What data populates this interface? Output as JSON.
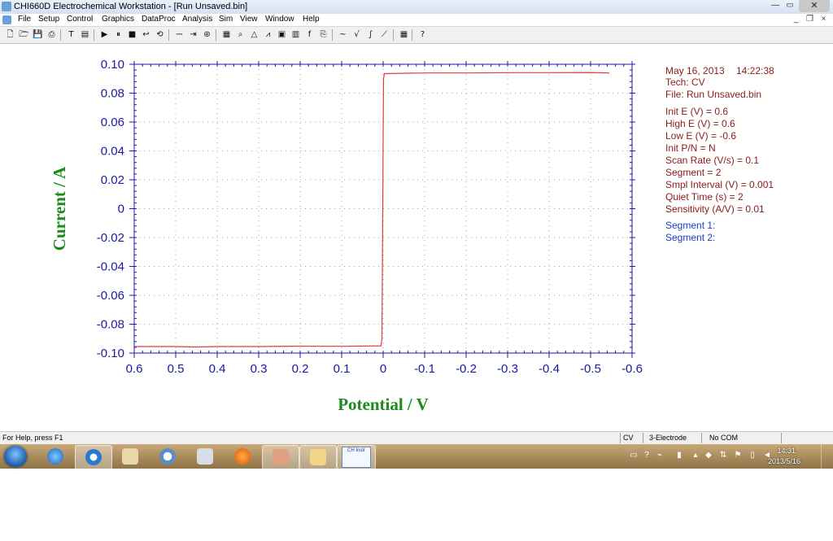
{
  "window": {
    "title": "CHI660D Electrochemical Workstation - [Run Unsaved.bin]",
    "min_glyph": "—",
    "max_glyph": "▭",
    "close_glyph": "✕",
    "mdi_min_glyph": "_",
    "mdi_restore_glyph": "❐",
    "mdi_close_glyph": "×"
  },
  "menu": [
    "File",
    "Setup",
    "Control",
    "Graphics",
    "DataProc",
    "Analysis",
    "Sim",
    "View",
    "Window",
    "Help"
  ],
  "toolbar": [
    {
      "icon": "new-file-icon",
      "glyph": "🗋"
    },
    {
      "icon": "open-folder-icon",
      "glyph": "🗁"
    },
    {
      "icon": "save-icon",
      "glyph": "💾"
    },
    {
      "icon": "print-icon",
      "glyph": "⎙"
    },
    {
      "icon": "technique-icon",
      "glyph": "T"
    },
    {
      "icon": "parameters-icon",
      "glyph": "▤"
    },
    {
      "icon": "run-icon",
      "glyph": "▶"
    },
    {
      "icon": "pause-icon",
      "glyph": "⏸"
    },
    {
      "icon": "stop-icon",
      "glyph": "■"
    },
    {
      "icon": "reverse-icon",
      "glyph": "↩"
    },
    {
      "icon": "ir-comp-icon",
      "glyph": "⟲"
    },
    {
      "icon": "cell-icon",
      "glyph": "⎓"
    },
    {
      "icon": "step-icon",
      "glyph": "⇥"
    },
    {
      "icon": "rotate-icon",
      "glyph": "⊛"
    },
    {
      "icon": "graph-icon",
      "glyph": "▦"
    },
    {
      "icon": "zoom-icon",
      "glyph": "⌕"
    },
    {
      "icon": "peak-icon",
      "glyph": "△"
    },
    {
      "icon": "overlay-icon",
      "glyph": "⩘"
    },
    {
      "icon": "add-data-icon",
      "glyph": "▣"
    },
    {
      "icon": "color-icon",
      "glyph": "▥"
    },
    {
      "icon": "font-icon",
      "glyph": "f"
    },
    {
      "icon": "copy-icon",
      "glyph": "⎘"
    },
    {
      "icon": "smooth-icon",
      "glyph": "∼"
    },
    {
      "icon": "derivative-icon",
      "glyph": "√"
    },
    {
      "icon": "integrate-icon",
      "glyph": "∫"
    },
    {
      "icon": "baseline-icon",
      "glyph": "⟋"
    },
    {
      "icon": "info-icon",
      "glyph": "▦"
    },
    {
      "icon": "help-icon",
      "glyph": "?"
    }
  ],
  "chart_data": {
    "type": "line",
    "xlabel": "Potential / V",
    "ylabel": "Current / A",
    "xlim": [
      0.6,
      -0.6
    ],
    "ylim": [
      -0.1,
      0.1
    ],
    "x_reversed": true,
    "x_ticks": [
      "0.6",
      "0.5",
      "0.4",
      "0.3",
      "0.2",
      "0.1",
      "0",
      "-0.1",
      "-0.2",
      "-0.3",
      "-0.4",
      "-0.5",
      "-0.6"
    ],
    "y_ticks": [
      "0.10",
      "0.08",
      "0.06",
      "0.04",
      "0.02",
      "0",
      "-0.02",
      "-0.04",
      "-0.06",
      "-0.08",
      "-0.10"
    ],
    "grid": true,
    "series": [
      {
        "color": "#e03c3c",
        "x": [
          0.6,
          0.5,
          0.45,
          0.4,
          0.3,
          0.2,
          0.1,
          0.005,
          0.003,
          0.002,
          0.001,
          0.0,
          -0.001,
          -0.003,
          -0.1,
          -0.2,
          -0.3,
          -0.4,
          -0.5,
          -0.545
        ],
        "y": [
          -0.0955,
          -0.0955,
          -0.0958,
          -0.0955,
          -0.0955,
          -0.0952,
          -0.0953,
          -0.095,
          -0.09,
          -0.05,
          0.0,
          0.05,
          0.09,
          0.0935,
          0.094,
          0.094,
          0.0942,
          0.0942,
          0.0943,
          0.094
        ]
      }
    ]
  },
  "info": {
    "date": "May 16, 2013",
    "time": "14:22:38",
    "tech": "Tech: CV",
    "file": "File: Run Unsaved.bin",
    "params": [
      "Init E (V) = 0.6",
      "High E (V) = 0.6",
      "Low E (V) = -0.6",
      "Init P/N = N",
      "Scan Rate (V/s) = 0.1",
      "Segment = 2",
      "Smpl Interval (V) = 0.001",
      "Quiet Time (s) = 2",
      "Sensitivity (A/V) = 0.01"
    ],
    "segments": [
      "Segment 1:",
      "Segment 2:"
    ]
  },
  "status": {
    "help": "For Help, press F1",
    "tech": "CV",
    "electrode": "3-Electrode",
    "com": "No COM"
  },
  "taskbar": {
    "time": "14:31",
    "date": "2013/5/16",
    "chi_label": "CH Instr"
  },
  "colors": {
    "axis": "#1a1aa0",
    "axis_title": "#1c8a1c",
    "trace": "#e03c3c",
    "info_text": "#8b1a1a",
    "segment_text": "#1a3cc8"
  }
}
